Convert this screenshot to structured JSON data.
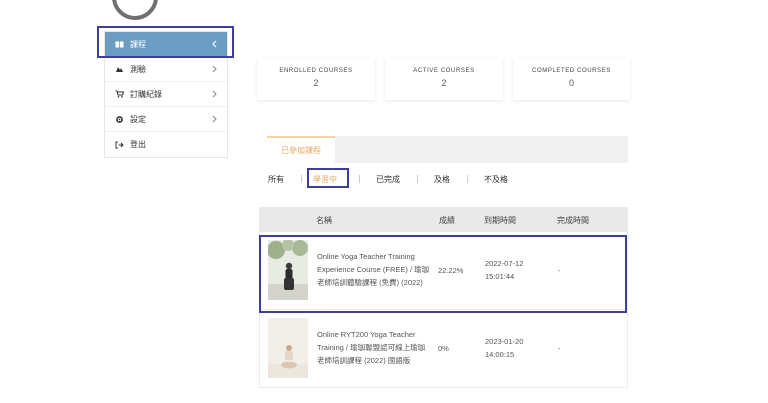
{
  "sidebar": {
    "items": [
      {
        "label": "課程",
        "icon": "book-icon"
      },
      {
        "label": "測驗",
        "icon": "quiz-icon"
      },
      {
        "label": "訂購紀錄",
        "icon": "cart-icon"
      },
      {
        "label": "設定",
        "icon": "gear-icon"
      },
      {
        "label": "登出",
        "icon": "logout-icon"
      }
    ]
  },
  "stats": {
    "enrolled": {
      "label": "ENROLLED COURSES",
      "value": "2"
    },
    "active": {
      "label": "ACTIVE COURSES",
      "value": "2"
    },
    "completed": {
      "label": "COMPLETED COURSES",
      "value": "0"
    }
  },
  "tabs": {
    "enrolled": "已參加課程"
  },
  "filters": {
    "all": "所有",
    "in_progress": "學習中",
    "completed": "已完成",
    "passed": "及格",
    "failed": "不及格"
  },
  "table": {
    "headers": {
      "name": "名稱",
      "grade": "成績",
      "due": "到期時間",
      "done": "完成時間"
    },
    "rows": [
      {
        "name": "Online Yoga Teacher Training Experience Course (FREE) / 瑜珈老師培訓體驗課程 (免費) (2022)",
        "grade": "22.22%",
        "due_date": "2022-07-12",
        "due_time": "15:01:44",
        "done": "-"
      },
      {
        "name": "Online RYT200 Yoga Teacher Training / 瑜珈聯盟認可線上瑜珈老師培訓課程 (2022) 國語版",
        "grade": "0%",
        "due_date": "2023-01-20",
        "due_time": "14:00:15",
        "done": "-"
      }
    ]
  },
  "colors": {
    "sidebar_active": "#6b9dc3",
    "tab_accent": "#e8a961",
    "highlight": "#3f3f9a"
  }
}
